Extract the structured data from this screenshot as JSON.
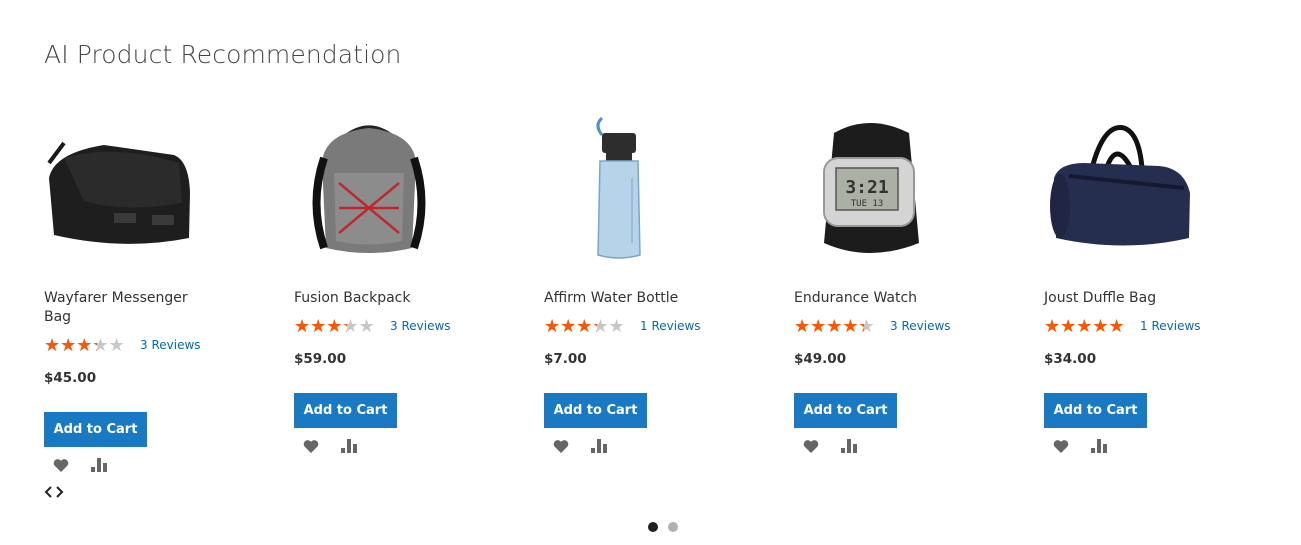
{
  "section": {
    "title": "AI Product Recommendation"
  },
  "products": [
    {
      "name": "Wayfarer Messenger Bag",
      "rating": 0.6,
      "reviews": "3 Reviews",
      "price": "$45.00",
      "cart_label": "Add to Cart",
      "image_icon": "messenger-bag-icon"
    },
    {
      "name": "Fusion Backpack",
      "rating": 0.6,
      "reviews": "3 Reviews",
      "price": "$59.00",
      "cart_label": "Add to Cart",
      "image_icon": "backpack-icon"
    },
    {
      "name": "Affirm Water Bottle",
      "rating": 0.6,
      "reviews": "1 Reviews",
      "price": "$7.00",
      "cart_label": "Add to Cart",
      "image_icon": "water-bottle-icon"
    },
    {
      "name": "Endurance Watch",
      "rating": 0.8,
      "reviews": "3 Reviews",
      "price": "$49.00",
      "cart_label": "Add to Cart",
      "image_icon": "watch-icon"
    },
    {
      "name": "Joust Duffle Bag",
      "rating": 1.0,
      "reviews": "1 Reviews",
      "price": "$34.00",
      "cart_label": "Add to Cart",
      "image_icon": "duffle-bag-icon"
    }
  ],
  "pagination": {
    "pages": 2,
    "active": 0
  },
  "colors": {
    "accent": "#1979c3",
    "star": "#ff5501",
    "link": "#006bb4"
  },
  "watch_display": {
    "time": "3:21",
    "date": "TUE 13"
  }
}
